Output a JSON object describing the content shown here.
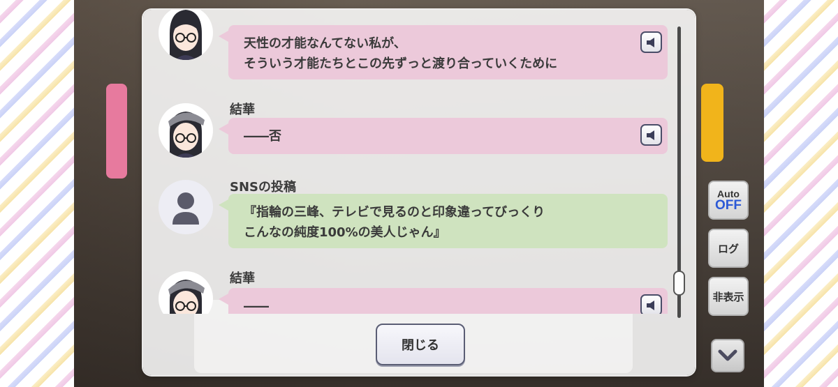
{
  "log": {
    "entries": [
      {
        "speaker": "",
        "avatar": "yuika-avatar",
        "bubble_color": "pink",
        "lines": [
          "天性の才能なんてない私が、",
          "そういう才能たちとこの先ずっと渡り合っていくために"
        ],
        "has_voice": true
      },
      {
        "speaker": "結華",
        "avatar": "yuika-avatar",
        "bubble_color": "pink",
        "lines": [
          "――否"
        ],
        "has_voice": true
      },
      {
        "speaker": "SNSの投稿",
        "avatar": "sns-silhouette",
        "bubble_color": "green",
        "lines": [
          "『指輪の三峰、テレビで見るのと印象違ってびっくり",
          "こんなの純度100%の美人じゃん』"
        ],
        "has_voice": false
      },
      {
        "speaker": "結華",
        "avatar": "yuika-avatar",
        "bubble_color": "pink",
        "lines": [
          "――"
        ],
        "has_voice": true
      }
    ],
    "close_label": "閉じる",
    "scroll_position": 0.85
  },
  "side_buttons": {
    "auto_label": "Auto",
    "auto_state": "OFF",
    "log_label": "ログ",
    "hide_label": "非表示"
  },
  "icons": {
    "voice": "speaker-icon",
    "down": "chevron-down-icon"
  },
  "colors": {
    "pink_bubble": "#ecc9da",
    "green_bubble": "#cfe3bf",
    "auto_off": "#2c59d6"
  }
}
